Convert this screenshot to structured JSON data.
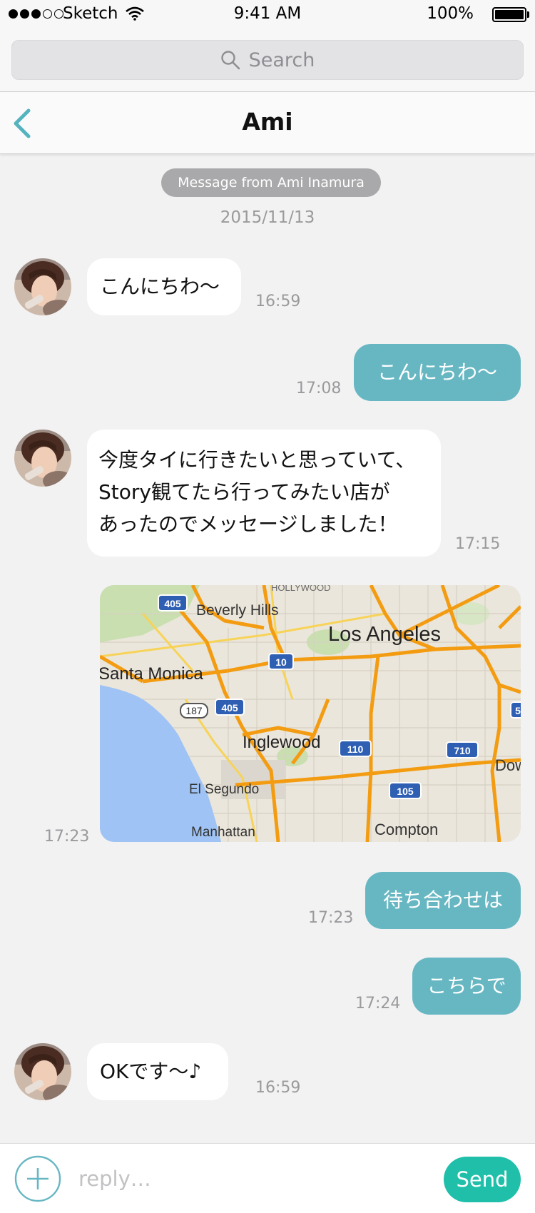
{
  "status_bar": {
    "carrier": "Sketch",
    "time": "9:41 AM",
    "battery": "100%"
  },
  "search": {
    "placeholder": "Search"
  },
  "nav": {
    "title": "Ami"
  },
  "chat": {
    "system_label": "Message from Ami Inamura",
    "date": "2015/11/13",
    "messages": [
      {
        "sender": "Ami",
        "text": "こんにちわ〜",
        "time": "16:59"
      },
      {
        "sender": "me",
        "text": "こんにちわ〜",
        "time": "17:08"
      },
      {
        "sender": "Ami",
        "lines": [
          "今度タイに行きたいと思っていて、",
          "Story観てたら行ってみたい店が",
          "あったのでメッセージしました！"
        ],
        "time": "17:15"
      },
      {
        "sender": "me",
        "type": "map",
        "time": "17:23"
      },
      {
        "sender": "me",
        "text": "待ち合わせは",
        "time": "17:23"
      },
      {
        "sender": "me",
        "text": "こちらで",
        "time": "17:24"
      },
      {
        "sender": "Ami",
        "text": "OKです〜♪",
        "time": "16:59"
      }
    ]
  },
  "map": {
    "labels": {
      "hollywood": "HOLLYWOOD",
      "beverly_hills": "Beverly Hills",
      "los_angeles": "Los Angeles",
      "santa_monica": "Santa Monica",
      "inglewood": "Inglewood",
      "el_segundo": "El Segundo",
      "manhattan": "Manhattan",
      "compton": "Compton",
      "downey": "Dow"
    },
    "shields": {
      "i405a": "405",
      "i10": "10",
      "i405b": "405",
      "r187": "187",
      "i110": "110",
      "i710": "710",
      "i105": "105",
      "i5": "5"
    }
  },
  "input": {
    "placeholder": "reply…",
    "send_label": "Send"
  },
  "colors": {
    "accent": "#67b7c3",
    "send": "#1fbfaa",
    "background": "#f2f2f3"
  }
}
